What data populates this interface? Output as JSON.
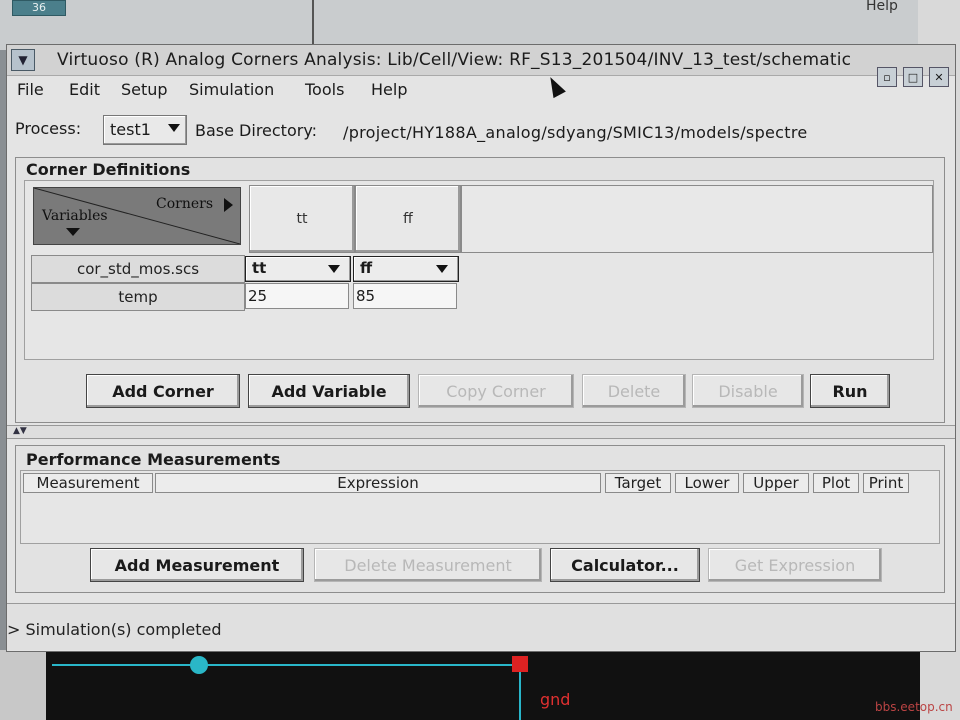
{
  "background": {
    "tab_label": "36",
    "help_label": "Help",
    "net_label": "gnd",
    "watermark": "bbs.eetop.cn"
  },
  "window": {
    "title": "Virtuoso (R) Analog Corners Analysis: Lib/Cell/View: RF_S13_201504/INV_13_test/schematic",
    "menu_icon": "chevron-down-icon",
    "controls": [
      "minimize-icon",
      "maximize-icon",
      "close-icon"
    ]
  },
  "menu": {
    "items": [
      "File",
      "Edit",
      "Setup",
      "Simulation",
      "Tools",
      "Help"
    ]
  },
  "process": {
    "label": "Process:",
    "value": "test1",
    "base_dir_label": "Base Directory:",
    "base_dir_value": "/project/HY188A_analog/sdyang/SMIC13/models/spectre"
  },
  "corners": {
    "title": "Corner Definitions",
    "header_corners": "Corners",
    "header_variables": "Variables",
    "columns": [
      "tt",
      "ff"
    ],
    "rows": [
      {
        "label": "cor_std_mos.scs",
        "values": [
          "tt",
          "ff"
        ],
        "type": "select"
      },
      {
        "label": "temp",
        "values": [
          "25",
          "85"
        ],
        "type": "text"
      }
    ],
    "buttons": {
      "add_corner": "Add Corner",
      "add_variable": "Add Variable",
      "copy_corner": "Copy Corner",
      "delete": "Delete",
      "disable": "Disable",
      "run": "Run"
    }
  },
  "performance": {
    "title": "Performance Measurements",
    "columns": [
      "Measurement",
      "Expression",
      "Target",
      "Lower",
      "Upper",
      "Plot",
      "Print"
    ],
    "buttons": {
      "add_measurement": "Add Measurement",
      "delete_measurement": "Delete Measurement",
      "calculator": "Calculator...",
      "get_expression": "Get Expression"
    }
  },
  "status": {
    "text": "> Simulation(s) completed"
  },
  "colors": {
    "window_bg": "#e4e4e4",
    "corner_header_bg": "#7a7a7a",
    "schematic_wire": "#29b6c9",
    "schematic_label": "#e03030"
  }
}
